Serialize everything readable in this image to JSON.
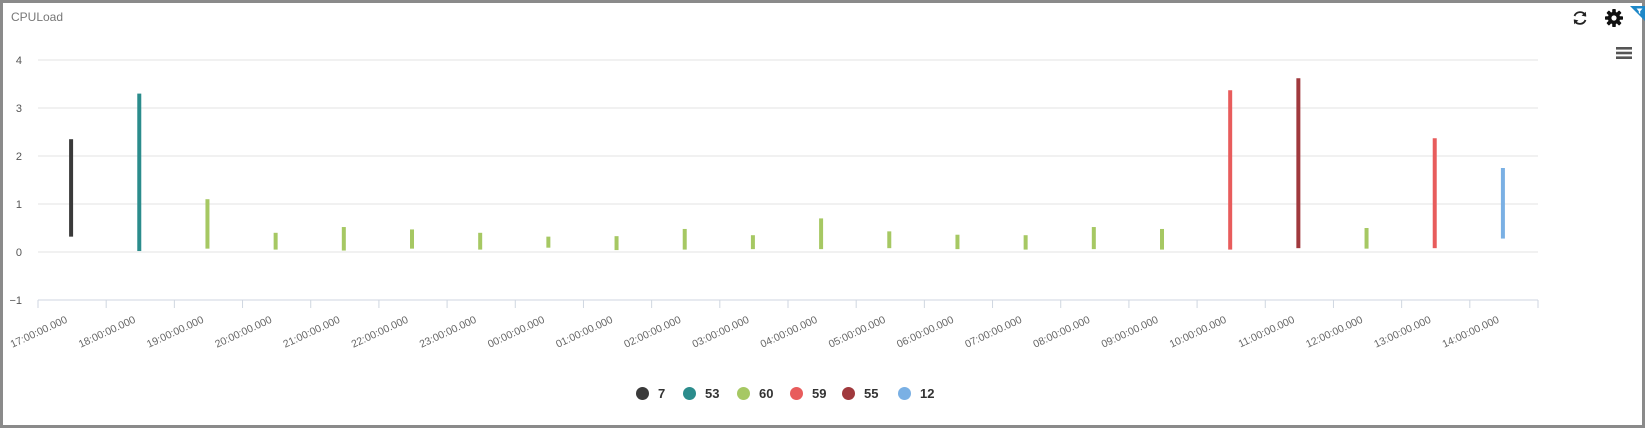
{
  "panel": {
    "title": "CPULoad"
  },
  "icons": {
    "refresh": "refresh-icon",
    "settings": "gear-icon",
    "corner": "filter-corner-icon",
    "menu": "hamburger-menu-icon"
  },
  "colors": {
    "corner_accent": "#1e88c8"
  },
  "chart_data": {
    "type": "bar",
    "categories": [
      "17:00:00.000",
      "18:00:00.000",
      "19:00:00.000",
      "20:00:00.000",
      "21:00:00.000",
      "22:00:00.000",
      "23:00:00.000",
      "00:00:00.000",
      "01:00:00.000",
      "02:00:00.000",
      "03:00:00.000",
      "04:00:00.000",
      "05:00:00.000",
      "06:00:00.000",
      "07:00:00.000",
      "08:00:00.000",
      "09:00:00.000",
      "10:00:00.000",
      "11:00:00.000",
      "12:00:00.000",
      "13:00:00.000",
      "14:00:00.000"
    ],
    "ylim": [
      -1,
      4
    ],
    "yticks": [
      -1,
      0,
      1,
      2,
      3,
      4
    ],
    "grid": true,
    "legend_position": "bottom-center",
    "series": [
      {
        "name": "7",
        "color": "#3a3a3a",
        "bars": [
          {
            "x": "17:00:00.000",
            "low": 0.32,
            "high": 2.35
          }
        ]
      },
      {
        "name": "53",
        "color": "#2b8c8c",
        "bars": [
          {
            "x": "18:00:00.000",
            "low": 0.02,
            "high": 3.3
          }
        ]
      },
      {
        "name": "60",
        "color": "#a6c863",
        "bars": [
          {
            "x": "19:00:00.000",
            "low": 0.07,
            "high": 1.1
          },
          {
            "x": "20:00:00.000",
            "low": 0.05,
            "high": 0.4
          },
          {
            "x": "21:00:00.000",
            "low": 0.03,
            "high": 0.52
          },
          {
            "x": "22:00:00.000",
            "low": 0.07,
            "high": 0.47
          },
          {
            "x": "23:00:00.000",
            "low": 0.05,
            "high": 0.4
          },
          {
            "x": "00:00:00.000",
            "low": 0.09,
            "high": 0.32
          },
          {
            "x": "01:00:00.000",
            "low": 0.04,
            "high": 0.33
          },
          {
            "x": "02:00:00.000",
            "low": 0.05,
            "high": 0.48
          },
          {
            "x": "03:00:00.000",
            "low": 0.06,
            "high": 0.35
          },
          {
            "x": "04:00:00.000",
            "low": 0.06,
            "high": 0.7
          },
          {
            "x": "05:00:00.000",
            "low": 0.08,
            "high": 0.43
          },
          {
            "x": "06:00:00.000",
            "low": 0.06,
            "high": 0.36
          },
          {
            "x": "07:00:00.000",
            "low": 0.05,
            "high": 0.35
          },
          {
            "x": "08:00:00.000",
            "low": 0.06,
            "high": 0.52
          },
          {
            "x": "09:00:00.000",
            "low": 0.05,
            "high": 0.48
          },
          {
            "x": "12:00:00.000",
            "low": 0.07,
            "high": 0.5
          }
        ]
      },
      {
        "name": "59",
        "color": "#e85c5c",
        "bars": [
          {
            "x": "10:00:00.000",
            "low": 0.05,
            "high": 3.37
          },
          {
            "x": "13:00:00.000",
            "low": 0.08,
            "high": 2.37
          }
        ]
      },
      {
        "name": "55",
        "color": "#a0393d",
        "bars": [
          {
            "x": "11:00:00.000",
            "low": 0.08,
            "high": 3.62
          }
        ]
      },
      {
        "name": "12",
        "color": "#7ab0e4",
        "bars": [
          {
            "x": "14:00:00.000",
            "low": 0.28,
            "high": 1.75
          }
        ]
      }
    ]
  }
}
